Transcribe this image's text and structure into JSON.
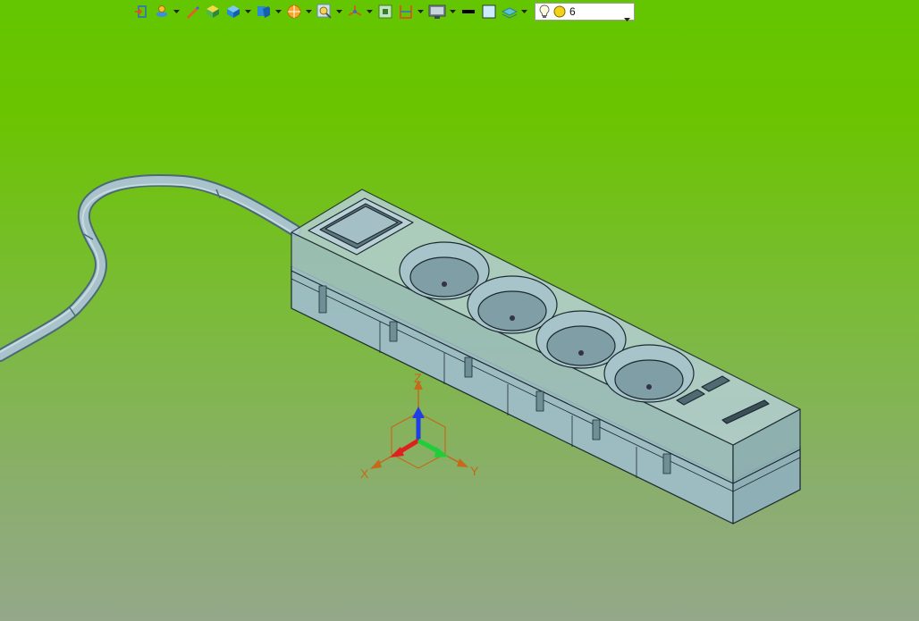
{
  "toolbar": {
    "items": [
      {
        "name": "exit-sketch-icon"
      },
      {
        "name": "inquire-icon"
      },
      {
        "name": "pencil-icon"
      },
      {
        "name": "cube-yellow-icon"
      },
      {
        "name": "view-orient-icon"
      },
      {
        "name": "named-view-icon"
      },
      {
        "name": "render-mode-icon"
      },
      {
        "name": "zoom-area-icon"
      },
      {
        "name": "triad-icon"
      },
      {
        "name": "fit-icon"
      },
      {
        "name": "section-view-icon"
      },
      {
        "name": "display-mode-icon"
      },
      {
        "name": "line-color-icon"
      },
      {
        "name": "background-icon"
      },
      {
        "name": "layer-icon"
      }
    ],
    "light_select": {
      "value": "6"
    }
  },
  "viewport": {
    "triad": {
      "x_label": "X",
      "y_label": "Y",
      "z_label": "Z"
    },
    "colors": {
      "x": "#e02020",
      "y": "#1fcf3a",
      "z": "#1f3fe6",
      "triad_frame": "#c46a1a"
    }
  }
}
